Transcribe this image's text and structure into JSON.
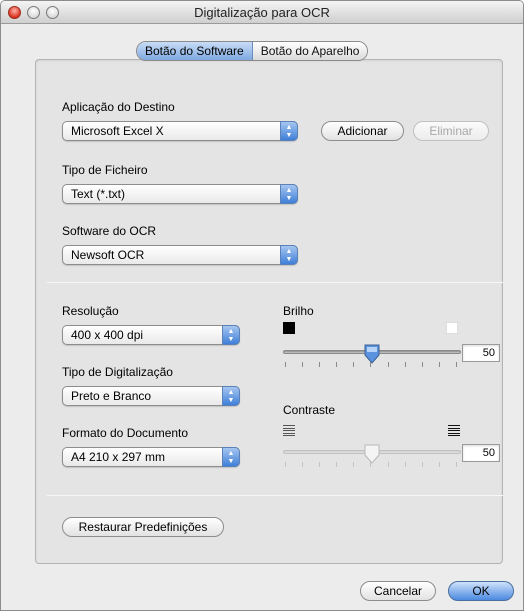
{
  "window": {
    "title": "Digitalização para OCR"
  },
  "tabs": [
    {
      "label": "Botão do Software",
      "active": true
    },
    {
      "label": "Botão do Aparelho",
      "active": false
    }
  ],
  "destination": {
    "label": "Aplicação do Destino",
    "value": "Microsoft Excel X",
    "add_label": "Adicionar",
    "remove_label": "Eliminar"
  },
  "file_type": {
    "label": "Tipo de Ficheiro",
    "value": "Text (*.txt)"
  },
  "ocr_software": {
    "label": "Software do OCR",
    "value": "Newsoft OCR"
  },
  "resolution": {
    "label": "Resolução",
    "value": "400 x 400 dpi"
  },
  "scan_type": {
    "label": "Tipo de Digitalização",
    "value": "Preto e Branco"
  },
  "document_size": {
    "label": "Formato do Documento",
    "value": "A4 210 x 297 mm"
  },
  "brightness": {
    "label": "Brilho",
    "value": "50",
    "level": 0.5,
    "enabled": true
  },
  "contrast": {
    "label": "Contraste",
    "value": "50",
    "level": 0.5,
    "enabled": false
  },
  "restore_label": "Restaurar Predefinições",
  "footer": {
    "cancel_label": "Cancelar",
    "ok_label": "OK"
  },
  "colors": {
    "accent": "#4b8ae0",
    "window_bg": "#ececec",
    "panel_bg": "#e4e4e4"
  },
  "icons": [
    "close-icon",
    "minimize-icon",
    "zoom-icon",
    "popup-arrows-icon",
    "black-square-icon",
    "white-square-icon",
    "contrast-low-icon",
    "contrast-high-icon",
    "slider-thumb-icon"
  ]
}
